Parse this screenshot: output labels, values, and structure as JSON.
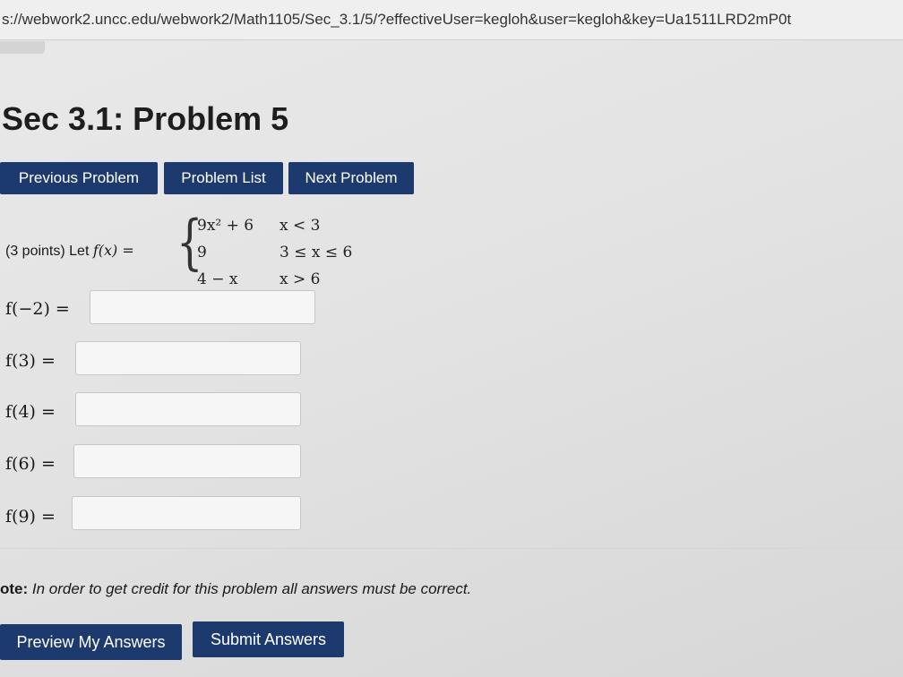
{
  "browser": {
    "url": "s://webwork2.uncc.edu/webwork2/Math1105/Sec_3.1/5/?effectiveUser=kegloh&user=kegloh&key=Ua1511LRD2mP0t"
  },
  "page": {
    "title": "Sec 3.1: Problem 5"
  },
  "nav": {
    "previous": "Previous Problem",
    "list": "Problem List",
    "next": "Next Problem"
  },
  "problem": {
    "points": "(3 points) Let ",
    "func": "f(x)",
    "equals": " = ",
    "pieces": [
      {
        "expr": "9x² + 6",
        "cond": "x < 3"
      },
      {
        "expr": "9",
        "cond": "3 ≤ x ≤ 6"
      },
      {
        "expr": "4 − x",
        "cond": "x > 6"
      }
    ]
  },
  "questions": [
    {
      "label": "f(−2) =",
      "value": ""
    },
    {
      "label": "f(3) =",
      "value": ""
    },
    {
      "label": "f(4) =",
      "value": ""
    },
    {
      "label": "f(6) =",
      "value": ""
    },
    {
      "label": "f(9) =",
      "value": ""
    }
  ],
  "note": {
    "prefix": "ote:",
    "text": " In order to get credit for this problem all answers must be correct."
  },
  "actions": {
    "preview": "Preview My Answers",
    "submit": "Submit Answers"
  }
}
